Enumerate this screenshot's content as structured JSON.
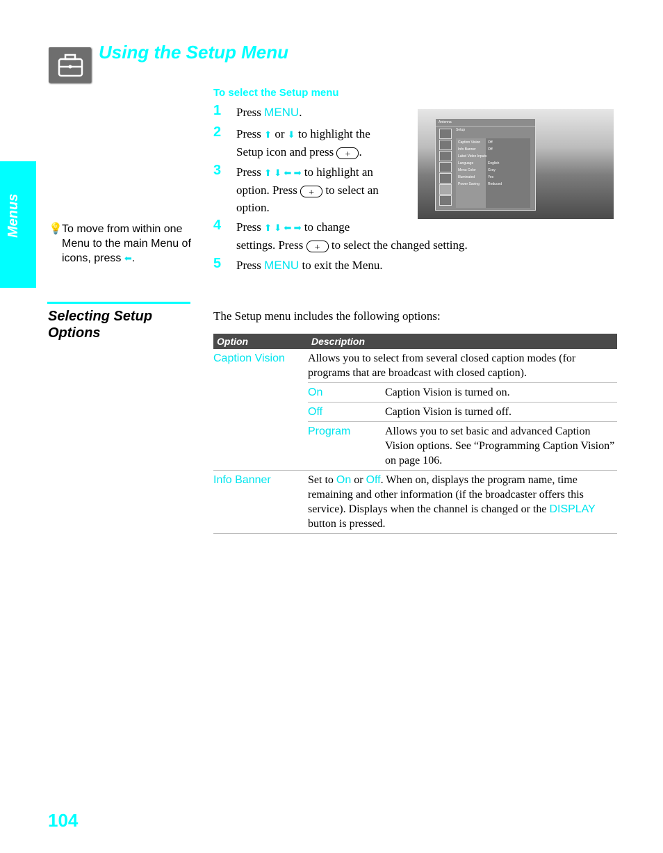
{
  "title": "Using the Setup Menu",
  "side_tab": "Menus",
  "subheading": "To select the Setup menu",
  "steps": [
    {
      "n": "1",
      "a": "Press ",
      "key": "MENU",
      "b": "."
    },
    {
      "n": "2",
      "a": "Press ",
      "b": " or ",
      "c": " to highlight the",
      "d": "Setup icon and press ",
      "e": "."
    },
    {
      "n": "3",
      "a": "Press ",
      "b": " to highlight an",
      "c": "option. Press ",
      "d": " to select an",
      "e": "option."
    },
    {
      "n": "4",
      "a": "Press ",
      "b": " to change",
      "c": "settings. Press ",
      "d": " to select the changed setting."
    },
    {
      "n": "5",
      "a": "Press ",
      "key": "MENU",
      "b": " to exit the Menu."
    }
  ],
  "tip": {
    "text": "To move from within one Menu to the main Menu of icons, press ",
    "end": "."
  },
  "section_title": "Selecting Setup Options",
  "intro": "The Setup menu includes the following options:",
  "table": {
    "headers": [
      "Option",
      "Description"
    ],
    "caption_vision": {
      "label": "Caption Vision",
      "desc": "Allows you to select from several closed caption modes (for programs that are broadcast with closed caption).",
      "subs": [
        {
          "label": "On",
          "desc": "Caption Vision is turned on."
        },
        {
          "label": "Off",
          "desc": "Caption Vision is turned off."
        },
        {
          "label": "Program",
          "desc": "Allows you to set basic and advanced Caption Vision options. See “Programming Caption Vision” on page 106."
        }
      ]
    },
    "info_banner": {
      "label": "Info Banner",
      "a": "Set to ",
      "on": "On",
      "b": " or ",
      "off": "Off",
      "c": ". When on, displays the program name, time remaining and other information (if the broadcaster offers this service). Displays when the channel is changed or the ",
      "display": "DISPLAY",
      "d": " button is pressed."
    }
  },
  "screenshot": {
    "header": "Antenna",
    "menu_title": "Setup",
    "rows": [
      [
        "Caption Vision",
        "Off"
      ],
      [
        "Info Banner",
        "Off"
      ],
      [
        "Label Video Inputs",
        ""
      ],
      [
        "Language",
        "English"
      ],
      [
        "Menu Color",
        "Gray"
      ],
      [
        "Illuminated",
        "Yes"
      ],
      [
        "Power Saving",
        "Reduced"
      ]
    ]
  },
  "page_number": "104",
  "accent": "#00ffff"
}
